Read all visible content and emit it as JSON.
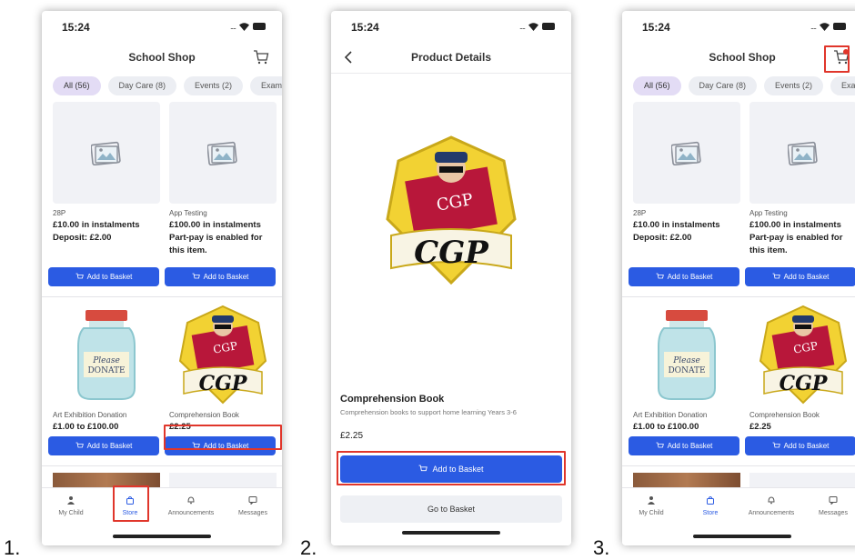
{
  "step_labels": [
    "1.",
    "2.",
    "3."
  ],
  "status_time": "15:24",
  "shop_title": "School Shop",
  "filters": [
    "All (56)",
    "Day Care (8)",
    "Events (2)",
    "Exam"
  ],
  "products": [
    {
      "name": "28P",
      "price_line1": "£10.00 in instalments",
      "price_line2": "Deposit: £2.00",
      "image": "placeholder-image-icon"
    },
    {
      "name": "App Testing",
      "price_line1": "£100.00 in instalments",
      "price_line2": "Part-pay is enabled for",
      "price_line3": "this item.",
      "image": "placeholder-image-icon"
    },
    {
      "name": "Art Exhibition Donation",
      "price_line1": "£1.00 to £100.00",
      "image": "donation-jar"
    },
    {
      "name": "Comprehension Book",
      "price_line1": "£2.25",
      "image": "cgp-logo"
    }
  ],
  "add_to_basket_label": "Add to Basket",
  "tabs": [
    "My Child",
    "Store",
    "Announcements",
    "Messages"
  ],
  "jar_text_line1": "Please",
  "jar_text_line2": "DONATE",
  "cgp_text": "CGP",
  "cgp_small": "CGP",
  "detail": {
    "title": "Product Details",
    "name": "Comprehension Book",
    "description": "Comprehension books to support home learning Years 3-6",
    "price": "£2.25",
    "add_label": "Add to Basket",
    "go_label": "Go to Basket"
  },
  "colors": {
    "accent": "#2b5be3",
    "highlight": "#e0362b",
    "chip_active": "#e3dcf5"
  }
}
